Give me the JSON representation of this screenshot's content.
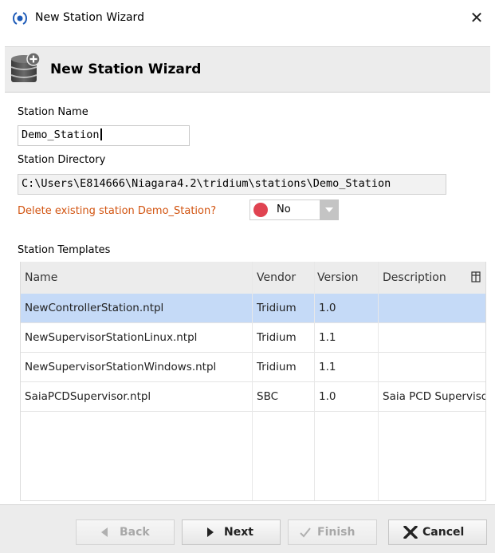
{
  "window": {
    "title": "New Station Wizard",
    "close_glyph": "✕",
    "logo_icon": "niagara-logo-icon"
  },
  "header": {
    "title": "New Station Wizard",
    "icon": "station-add-icon"
  },
  "form": {
    "station_name_label": "Station Name",
    "station_name_value": "Demo_Station",
    "station_directory_label": "Station Directory",
    "station_directory_value": "C:\\Users\\E814666\\Niagara4.2\\tridium\\stations\\Demo_Station",
    "delete_prompt": "Delete existing station Demo_Station?",
    "delete_value": "No",
    "delete_status_color": "#e04351"
  },
  "templates": {
    "label": "Station Templates",
    "columns": [
      "Name",
      "Vendor",
      "Version",
      "Description"
    ],
    "column_chooser_icon": "column-chooser-icon",
    "rows": [
      {
        "name": "NewControllerStation.ntpl",
        "vendor": "Tridium",
        "version": "1.0",
        "description": "",
        "selected": true
      },
      {
        "name": "NewSupervisorStationLinux.ntpl",
        "vendor": "Tridium",
        "version": "1.1",
        "description": "",
        "selected": false
      },
      {
        "name": "NewSupervisorStationWindows.ntpl",
        "vendor": "Tridium",
        "version": "1.1",
        "description": "",
        "selected": false
      },
      {
        "name": "SaiaPCDSupervisor.ntpl",
        "vendor": "SBC",
        "version": "1.0",
        "description": "Saia PCD Supervisor",
        "selected": false
      }
    ]
  },
  "buttons": {
    "back": "Back",
    "next": "Next",
    "finish": "Finish",
    "cancel": "Cancel"
  },
  "colors": {
    "selection": "#c5daf7",
    "warning_text": "#d2530f",
    "header_bg": "#ececec"
  }
}
